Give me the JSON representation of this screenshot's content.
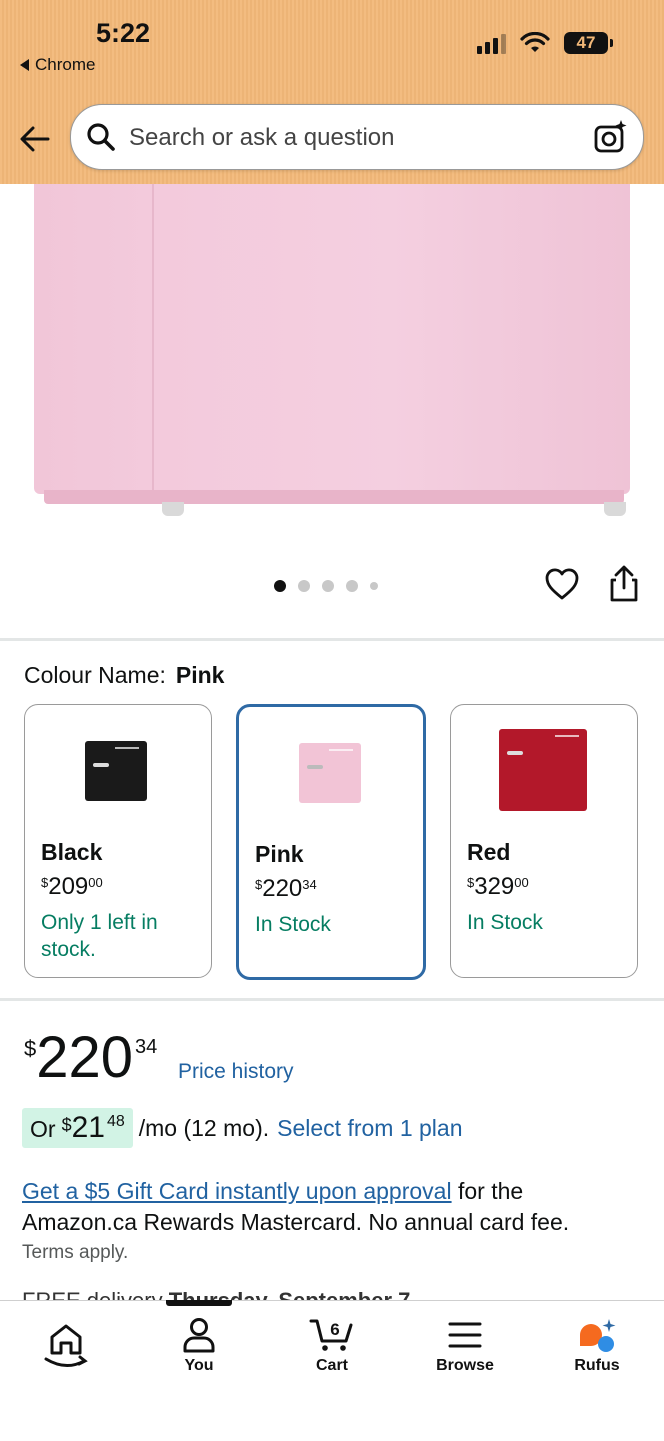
{
  "status_bar": {
    "time": "5:22",
    "back_app": "Chrome",
    "battery": "47"
  },
  "search": {
    "placeholder": "Search or ask a question"
  },
  "gallery": {
    "dot_count": 5,
    "active_dot": 0
  },
  "colour": {
    "label": "Colour Name:",
    "selected": "Pink"
  },
  "variants": [
    {
      "name": "Black",
      "price_currency": "$",
      "price_whole": "209",
      "price_fraction": "00",
      "stock": "Only 1 left in stock.",
      "color": "#1a1a1a",
      "selected": false
    },
    {
      "name": "Pink",
      "price_currency": "$",
      "price_whole": "220",
      "price_fraction": "34",
      "stock": "In Stock",
      "color": "#f2c4d6",
      "selected": true
    },
    {
      "name": "Red",
      "price_currency": "$",
      "price_whole": "329",
      "price_fraction": "00",
      "stock": "In Stock",
      "color": "#b3182a",
      "selected": false
    }
  ],
  "price": {
    "currency": "$",
    "whole": "220",
    "fraction": "34",
    "history_link": "Price history"
  },
  "monthly": {
    "prefix": "Or",
    "currency": "$",
    "whole": "21",
    "fraction": "48",
    "suffix": "/mo (12 mo).",
    "plan_link": "Select from 1 plan"
  },
  "promo": {
    "link_text": "Get a $5 Gift Card instantly upon approval",
    "text": " for the Amazon.ca Rewards Mastercard. No annual card fee.",
    "terms": "Terms apply."
  },
  "delivery_cutoff": {
    "text": "FREE delivery",
    "bold": "Thursday, September 7"
  },
  "bottom_nav": {
    "items": [
      {
        "label": "",
        "icon": "home-icon"
      },
      {
        "label": "You",
        "icon": "user-icon"
      },
      {
        "label": "Cart",
        "icon": "cart-icon",
        "count": "6"
      },
      {
        "label": "Browse",
        "icon": "menu-icon"
      },
      {
        "label": "Rufus",
        "icon": "rufus-icon"
      }
    ]
  },
  "colors": {
    "header_bg": "#f2b878",
    "link": "#2162a1",
    "in_stock": "#067d62",
    "selected_border": "#2f6aa5",
    "monthly_highlight": "#d2f3e5"
  }
}
